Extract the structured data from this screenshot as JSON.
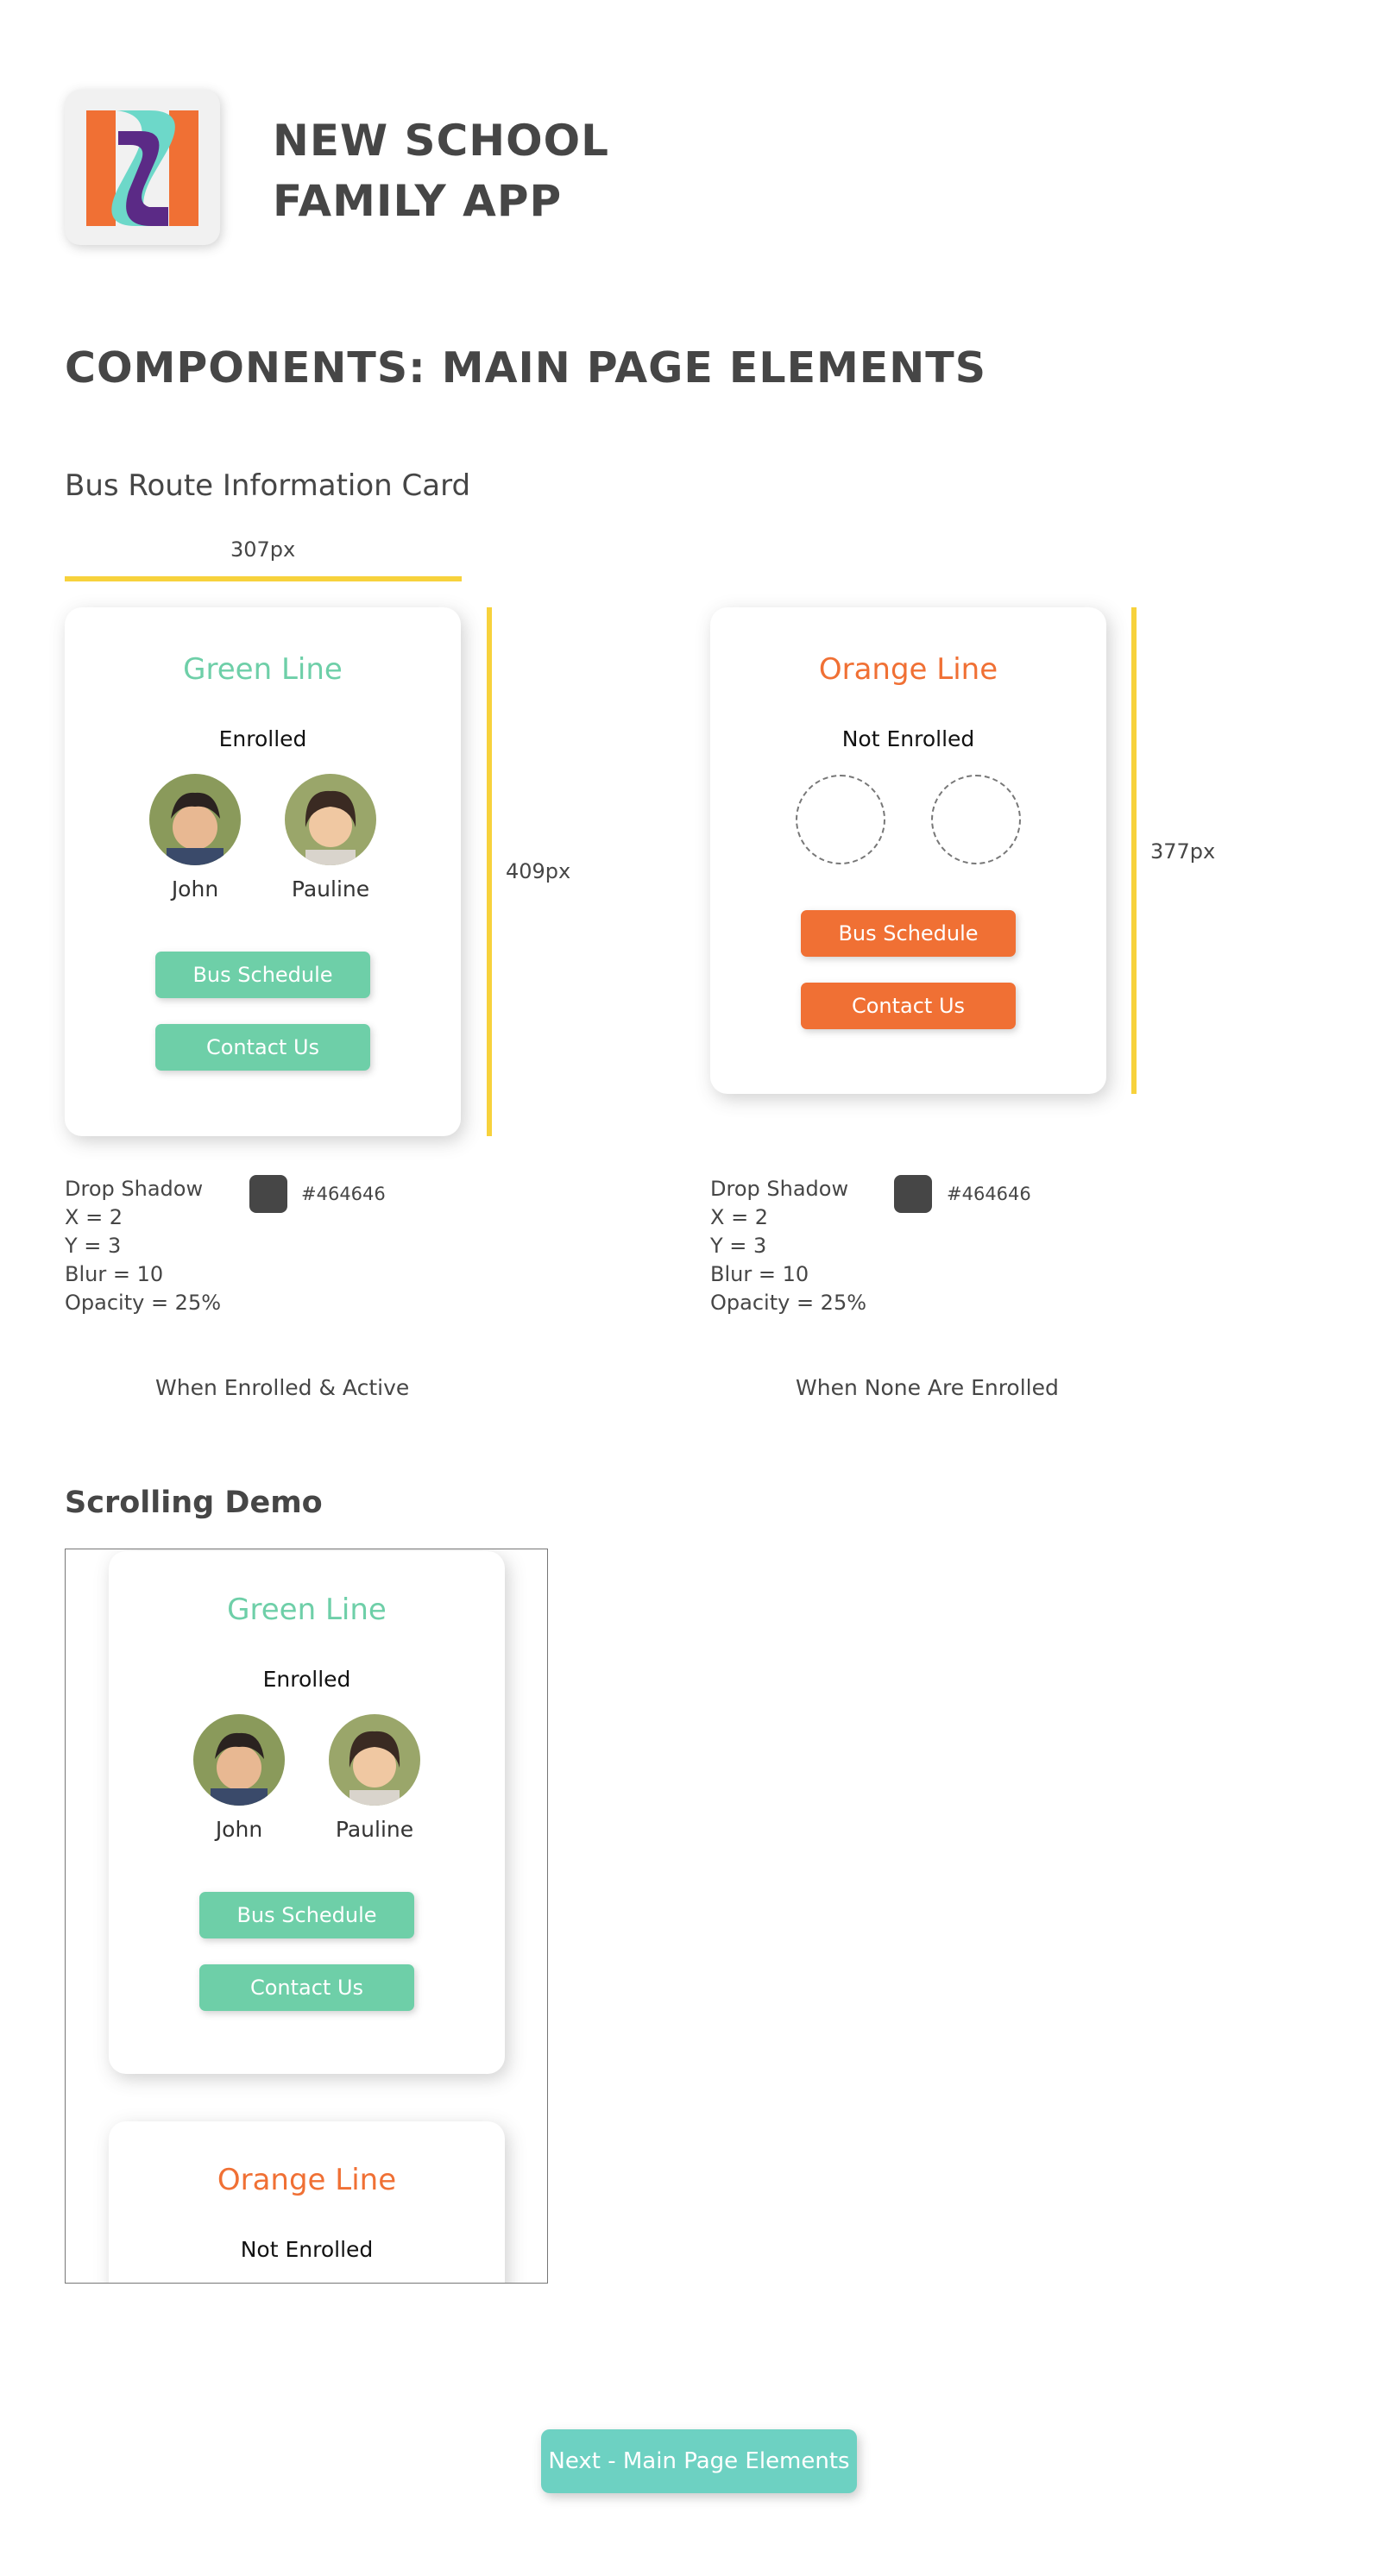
{
  "header": {
    "app_title_line1": "NEW SCHOOL",
    "app_title_line2": "FAMILY APP",
    "page_heading": "COMPONENTS: MAIN PAGE ELEMENTS"
  },
  "bus_card_section": {
    "title": "Bus Route Information Card",
    "width_label": "307px",
    "height_label_enrolled": "409px",
    "height_label_not_enrolled": "377px"
  },
  "cards": {
    "green": {
      "title": "Green Line",
      "status": "Enrolled",
      "children": [
        "John",
        "Pauline"
      ],
      "button_schedule": "Bus Schedule",
      "button_contact": "Contact Us",
      "color": "#6ecfa8"
    },
    "orange": {
      "title": "Orange Line",
      "status": "Not Enrolled",
      "button_schedule": "Bus Schedule",
      "button_contact": "Contact Us",
      "color": "#f07034"
    }
  },
  "shadow_spec": {
    "label": "Drop Shadow",
    "x": "X = 2",
    "y": "Y = 3",
    "blur": "Blur = 10",
    "opacity": "Opacity = 25%",
    "color_hex": "#464646"
  },
  "captions": {
    "enrolled": "When Enrolled & Active",
    "none_enrolled": "When None Are Enrolled"
  },
  "scrolling_demo": {
    "title": "Scrolling Demo"
  },
  "footer": {
    "next_button": "Next - Main Page Elements"
  },
  "colors": {
    "text_dark": "#464646",
    "accent_yellow": "#f7d23c",
    "green_line": "#6ecfa8",
    "orange_line": "#f07034",
    "logo_teal": "#6dd8c9",
    "logo_purple": "#5b2a86",
    "next_button": "#6dd1c2"
  }
}
